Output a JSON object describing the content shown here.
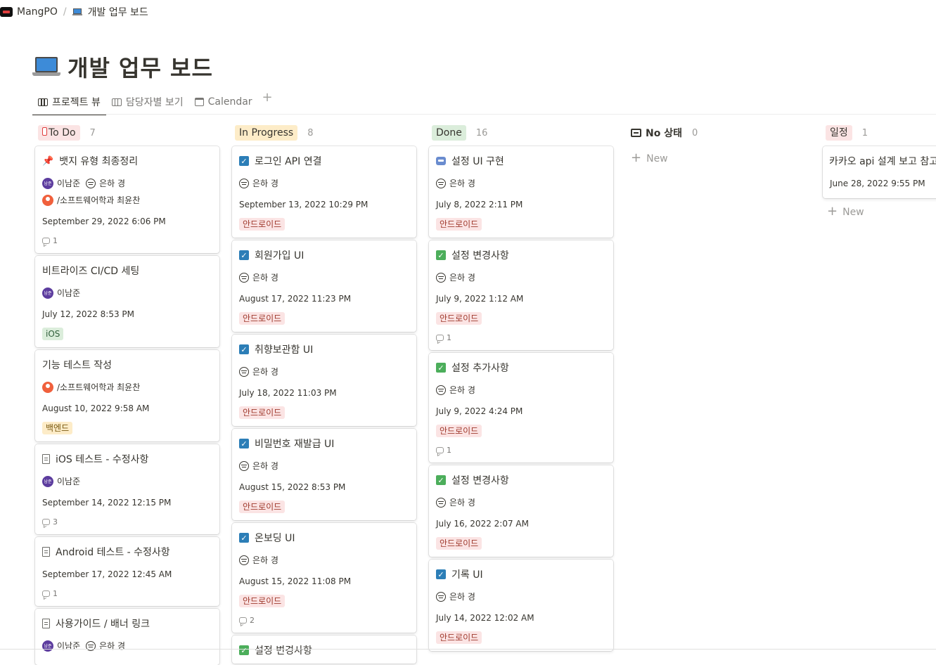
{
  "breadcrumb": {
    "workspace": "MangPO",
    "separator": "/",
    "page": "개발 업무 보드"
  },
  "page_title": "개발 업무 보드",
  "views": [
    {
      "label": "프로젝트 뷰",
      "icon": "board-icon",
      "active": true
    },
    {
      "label": "담당자별 보기",
      "icon": "board-icon",
      "active": false
    },
    {
      "label": "Calendar",
      "icon": "calendar-icon",
      "active": false
    }
  ],
  "colors": {
    "todo_pill": "#fbe4e4",
    "inprogress_pill": "#fdecc8",
    "done_pill": "#dbeddb",
    "schedule_pill": "#fbe4e4",
    "tag_android": "#fbe4e4",
    "tag_ios": "#dbeddb",
    "tag_backend": "#fdecc8",
    "checkbox_blue": "#2c7eb7",
    "checkbox_green": "#4cae5b"
  },
  "columns": {
    "todo": {
      "label": "To Do",
      "count": "7",
      "cards": [
        {
          "title": "뱃지 유형 최종정리",
          "assignee1": "이남준",
          "assignee2": "은하 경",
          "assignee3": "/소프트웨어학과 최윤찬",
          "date": "September 29, 2022 6:06 PM",
          "comments": "1"
        },
        {
          "title": "비트라이즈 CI/CD 세팅",
          "assignee1": "이남준",
          "date": "July 12, 2022 8:53 PM",
          "tag": "iOS"
        },
        {
          "title": "기능 테스트 작성",
          "assignee1": "/소프트웨어학과 최윤찬",
          "date": "August 10, 2022 9:58 AM",
          "tag": "백엔드"
        },
        {
          "title": "iOS 테스트 - 수정사항",
          "assignee1": "이남준",
          "date": "September 14, 2022 12:15 PM",
          "comments": "3"
        },
        {
          "title": "Android 테스트 - 수정사항",
          "date": "September 17, 2022 12:45 AM",
          "comments": "1"
        },
        {
          "title": "사용가이드 / 배너 링크",
          "assignee1": "이남준",
          "assignee2": "은하 경"
        }
      ]
    },
    "inprogress": {
      "label": "In Progress",
      "count": "8",
      "cards": [
        {
          "title": "로그인 API 연결",
          "assignee1": "은하 경",
          "date": "September 13, 2022 10:29 PM",
          "tag": "안드로이드"
        },
        {
          "title": "회원가입 UI",
          "assignee1": "은하 경",
          "date": "August 17, 2022 11:23 PM",
          "tag": "안드로이드"
        },
        {
          "title": "취향보관함 UI",
          "assignee1": "은하 경",
          "date": "July 18, 2022 11:03 PM",
          "tag": "안드로이드"
        },
        {
          "title": "비밀번호 재발급 UI",
          "assignee1": "은하 경",
          "date": "August 15, 2022 8:53 PM",
          "tag": "안드로이드"
        },
        {
          "title": "온보딩 UI",
          "assignee1": "은하 경",
          "date": "August 15, 2022 11:08 PM",
          "tag": "안드로이드",
          "comments": "2"
        },
        {
          "title": "설정 변경사항"
        }
      ]
    },
    "done": {
      "label": "Done",
      "count": "16",
      "cards": [
        {
          "title": "설정 UI 구현",
          "assignee1": "은하 경",
          "date": "July 8, 2022 2:11 PM",
          "tag": "안드로이드"
        },
        {
          "title": "설정 변경사항",
          "assignee1": "은하 경",
          "date": "July 9, 2022 1:12 AM",
          "tag": "안드로이드",
          "comments": "1"
        },
        {
          "title": "설정 추가사항",
          "assignee1": "은하 경",
          "date": "July 9, 2022 4:24 PM",
          "tag": "안드로이드",
          "comments": "1"
        },
        {
          "title": "설정 변경사항",
          "assignee1": "은하 경",
          "date": "July 16, 2022 2:07 AM",
          "tag": "안드로이드"
        },
        {
          "title": "기록 UI",
          "assignee1": "은하 경",
          "date": "July 14, 2022 12:02 AM",
          "tag": "안드로이드"
        }
      ]
    },
    "nostatus": {
      "label": "No 상태",
      "count": "0",
      "new_label": "New"
    },
    "schedule": {
      "label": "일정",
      "count": "1",
      "new_label": "New",
      "cards": [
        {
          "title": "카카오 api 설계 보고 참고",
          "date": "June 28, 2022 9:55 PM"
        }
      ]
    }
  }
}
